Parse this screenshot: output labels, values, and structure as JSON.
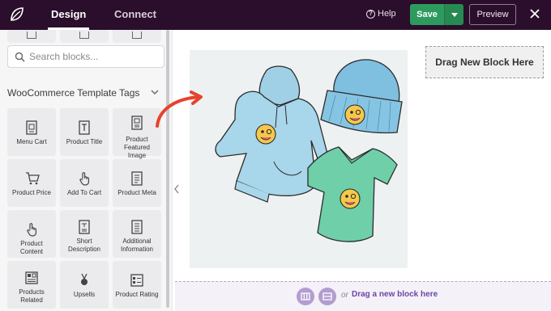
{
  "topbar": {
    "tabs": [
      {
        "label": "Design",
        "active": true
      },
      {
        "label": "Connect",
        "active": false
      }
    ],
    "help_label": "Help",
    "save_label": "Save",
    "preview_label": "Preview"
  },
  "sidebar": {
    "search_placeholder": "Search blocks...",
    "section_title": "WooCommerce Template Tags",
    "blocks": [
      {
        "label": "Menu Cart",
        "icon": "menu-cart-icon"
      },
      {
        "label": "Product Title",
        "icon": "product-title-icon"
      },
      {
        "label": "Product Featured Image",
        "icon": "product-image-icon"
      },
      {
        "label": "Product Price",
        "icon": "cart-price-icon"
      },
      {
        "label": "Add To Cart",
        "icon": "pointer-hand-icon"
      },
      {
        "label": "Product Meta",
        "icon": "product-meta-icon"
      },
      {
        "label": "Product Content",
        "icon": "pointer-hand-icon"
      },
      {
        "label": "Short Description",
        "icon": "text-doc-icon"
      },
      {
        "label": "Additional Information",
        "icon": "info-doc-icon"
      },
      {
        "label": "Products Related",
        "icon": "related-grid-icon"
      },
      {
        "label": "Upsells",
        "icon": "medal-icon"
      },
      {
        "label": "Product Rating",
        "icon": "rating-list-icon"
      }
    ]
  },
  "canvas": {
    "drag_block_label": "Drag New Block Here",
    "drop_or": "or",
    "drop_link": "Drag a new block here"
  },
  "colors": {
    "topbar_bg": "#2a0e2b",
    "save_green": "#2e9b5e",
    "accent_purple": "#6b47a3",
    "arrow_red": "#e8412c"
  }
}
